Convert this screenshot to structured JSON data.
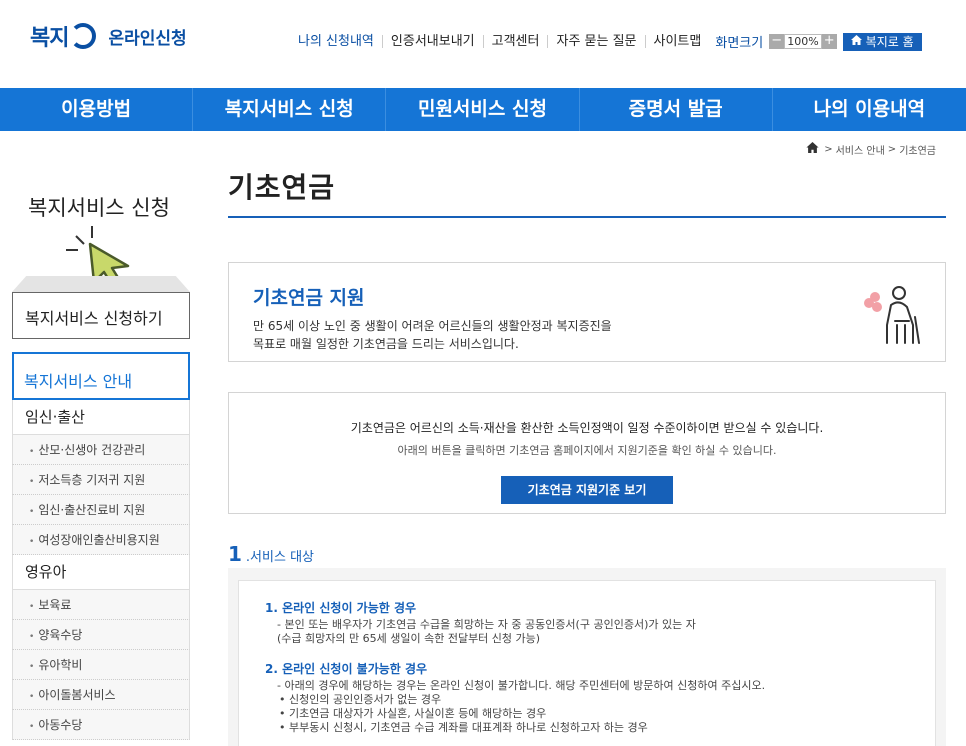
{
  "header": {
    "logo_mark": "복지",
    "logo_sub": "온라인신청",
    "utility_links": [
      "나의 신청내역",
      "인증서내보내기",
      "고객센터",
      "자주 묻는 질문",
      "사이트맵"
    ],
    "zoom_label": "화면크기",
    "zoom_minus": "−",
    "zoom_value": "100%",
    "zoom_plus": "+",
    "home_label": "복지로 홈"
  },
  "gnb": [
    "이용방법",
    "복지서비스 신청",
    "민원서비스 신청",
    "증명서 발급",
    "나의 이용내역"
  ],
  "sidebar": {
    "title": "복지서비스 신청",
    "apply_button": "복지서비스 신청하기",
    "guide_title": "복지서비스 안내",
    "cat1": "임신·출산",
    "cat1_items": [
      "산모·신생아 건강관리",
      "저소득층 기저귀 지원",
      "임신·출산진료비 지원",
      "여성장애인출산비용지원"
    ],
    "cat2": "영유아",
    "cat2_items": [
      "보육료",
      "양육수당",
      "유아학비",
      "아이돌봄서비스",
      "아동수당"
    ]
  },
  "breadcrumb": {
    "items": [
      "서비스 안내",
      "기초연금"
    ],
    "sep": ">"
  },
  "main": {
    "page_title": "기초연금",
    "support": {
      "title": "기초연금 지원",
      "desc1": "만 65세 이상 노인 중 생활이 어려운 어르신들의 생활안정과 복지증진을",
      "desc2": "목표로 매월 일정한 기초연금을 드리는 서비스입니다."
    },
    "notice": {
      "line1": "기초연금은 어르신의 소득·재산을 환산한 소득인정액이 일정 수준이하이면 받으실 수 있습니다.",
      "line2": "아래의 버튼을 클릭하면 기초연금 홈페이지에서 지원기준을 확인 하실 수 있습니다.",
      "button": "기초연금 지원기준 보기"
    },
    "section": {
      "num": "1",
      "title": ".서비스 대상",
      "group1": {
        "head": "1. 온라인 신청이 가능한 경우",
        "line1": "- 본인 또는 배우자가 기초연금 수급을 희망하는 자 중 공동인증서(구 공인인증서)가 있는 자",
        "line2": "(수급 희망자의 만 65세 생일이 속한 전달부터 신청 가능)"
      },
      "group2": {
        "head": "2. 온라인 신청이 불가능한 경우",
        "line1": "- 아래의 경우에 해당하는 경우는 온라인 신청이 불가합니다. 해당 주민센터에 방문하여 신청하여 주십시오.",
        "b1": "• 신청인의 공인인증서가 없는 경우",
        "b2": "• 기초연금 대상자가 사실혼, 사실이혼 등에 해당하는 경우",
        "b3": "• 부부동시 신청시, 기초연금 수급 계좌를 대표계좌 하나로 신청하고자 하는 경우"
      }
    }
  },
  "colors": {
    "primary": "#1575d6",
    "dark_blue": "#1660b8",
    "logo": "#0a4fa3",
    "cursor": "#c8d86a"
  },
  "icons": [
    "home-icon",
    "cursor-icon",
    "elder-icon",
    "plus-icon",
    "minus-icon"
  ]
}
